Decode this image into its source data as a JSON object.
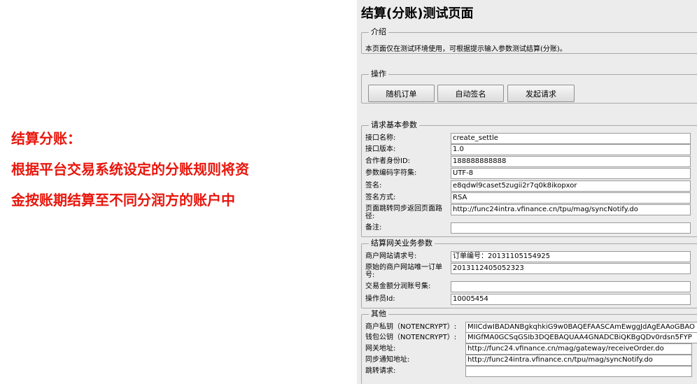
{
  "caption": {
    "line1": "结算分账：",
    "line2": "根据平台交易系统设定的分账规则将资",
    "line3": "金按账期结算至不同分润方的账户中"
  },
  "page": {
    "title": "结算(分账)测试页面"
  },
  "intro": {
    "legend": "介绍",
    "text": "本页面仅在测试环境使用，可根据提示输入参数测试结算(分账)。"
  },
  "actions": {
    "legend": "操作",
    "random_order": "随机订单",
    "auto_sign": "自动签名",
    "send_request": "发起请求"
  },
  "basic": {
    "legend": "请求基本参数",
    "fields": [
      {
        "label": "接口名称:",
        "value": "create_settle"
      },
      {
        "label": "接口版本:",
        "value": "1.0"
      },
      {
        "label": "合作者身份ID:",
        "value": "188888888888"
      },
      {
        "label": "参数编码字符集:",
        "value": "UTF-8"
      },
      {
        "label": "签名:",
        "value": "e8qdwl9caset5zugii2r7q0k8ikopxor"
      },
      {
        "label": "签名方式:",
        "value": "RSA"
      },
      {
        "label": "页面跳转同步返回页面路径:",
        "value": "http://func24intra.vfinance.cn/tpu/mag/syncNotify.do"
      },
      {
        "label": "备注:",
        "value": ""
      }
    ]
  },
  "gateway": {
    "legend": "结算网关业务参数",
    "fields": [
      {
        "label": "商户网站请求号:",
        "value": "订单编号：20131105154925"
      },
      {
        "label": "原始的商户网站唯一订单号:",
        "value": "2013112405052323"
      },
      {
        "label": "交易金额分润账号集:",
        "value": ""
      },
      {
        "label": "操作员Id:",
        "value": "10005454"
      }
    ]
  },
  "other": {
    "legend": "其他",
    "fields": [
      {
        "label": "商户私钥（NOTENCRYPT）:",
        "value": "MIICdwIBADANBgkqhkiG9w0BAQEFAASCAmEwggJdAgEAAoGBAO"
      },
      {
        "label": "钱包公钥（NOTENCRYPT）:",
        "value": "MIGfMA0GCSqGSIb3DQEBAQUAA4GNADCBiQKBgQDv0rdsn5FYP"
      },
      {
        "label": "网关地址:",
        "value": "http://func24.vfinance.cn/mag/gateway/receiveOrder.do"
      },
      {
        "label": "同步通知地址:",
        "value": "http://func24intra.vfinance.cn/tpu/mag/syncNotify.do"
      },
      {
        "label": "跳转请求:",
        "value": ""
      }
    ]
  }
}
